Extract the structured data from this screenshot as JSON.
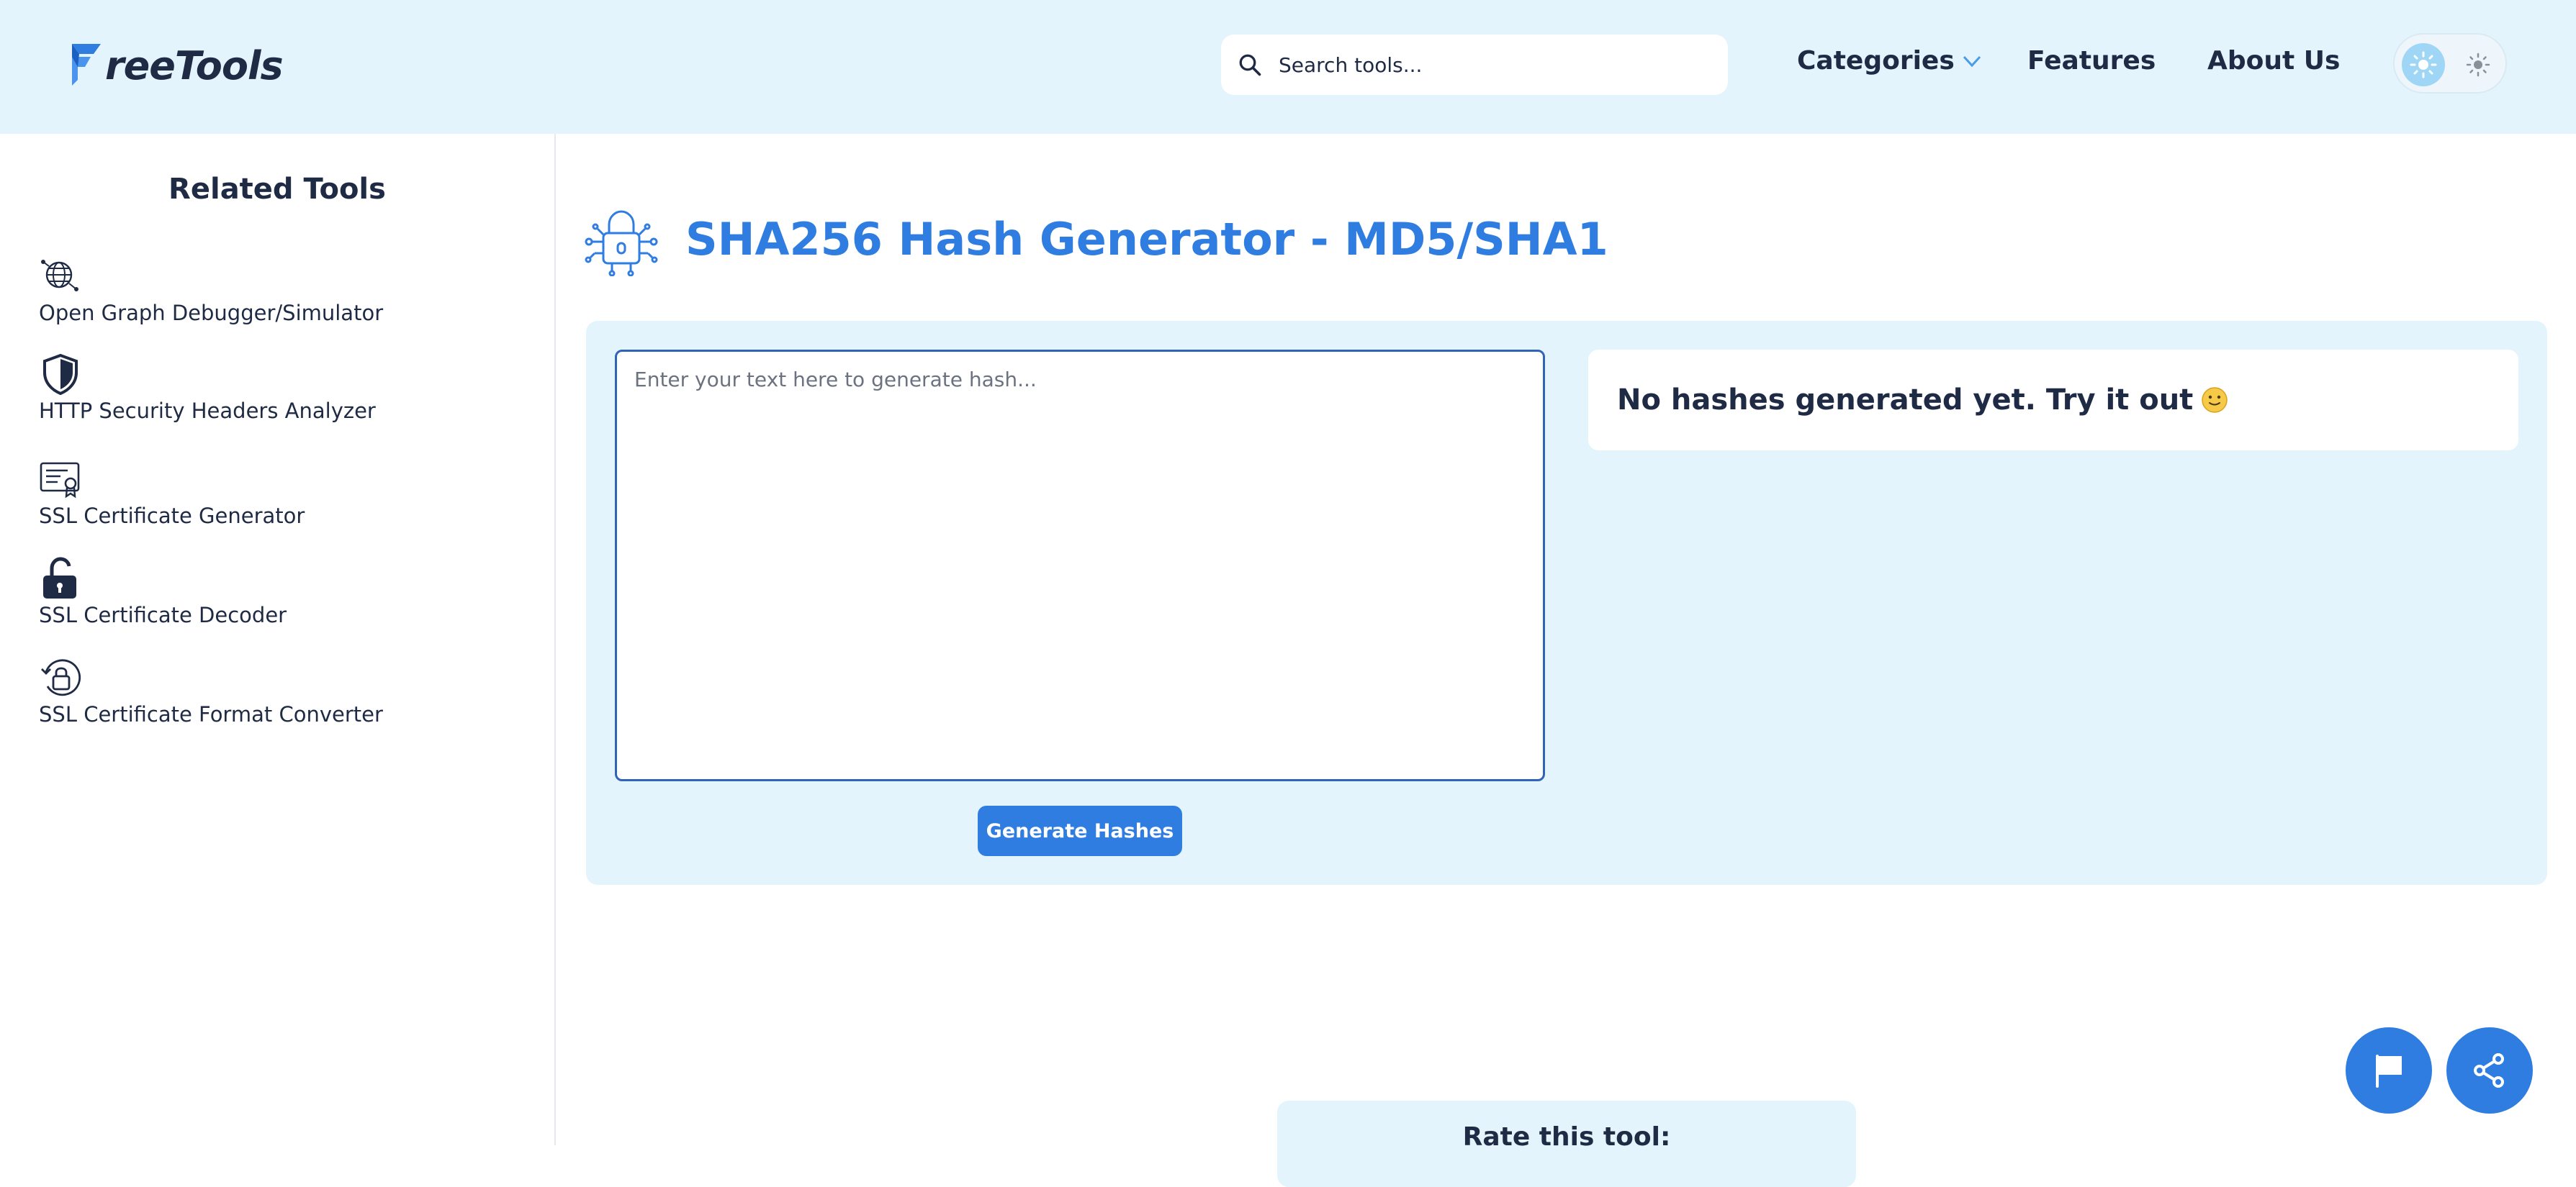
{
  "header": {
    "logo_text": "reeTools",
    "search_placeholder": "Search tools...",
    "nav": {
      "categories": "Categories",
      "features": "Features",
      "about": "About Us"
    }
  },
  "sidebar": {
    "title": "Related Tools",
    "items": [
      {
        "label": "Open Graph Debugger/Simulator",
        "icon": "globe-network-icon"
      },
      {
        "label": "HTTP Security Headers Analyzer",
        "icon": "shield-icon"
      },
      {
        "label": "SSL Certificate Generator",
        "icon": "certificate-icon"
      },
      {
        "label": "SSL Certificate Decoder",
        "icon": "unlock-icon"
      },
      {
        "label": "SSL Certificate Format Converter",
        "icon": "lock-rotate-icon"
      }
    ]
  },
  "main": {
    "title": "SHA256 Hash Generator - MD5/SHA1",
    "input_placeholder": "Enter your text here to generate hash...",
    "generate_label": "Generate Hashes",
    "result_text": "No hashes generated yet. Try it out"
  },
  "rating": {
    "title": "Rate this tool:"
  },
  "colors": {
    "accent": "#2f7de1",
    "header_bg": "#e3f4fc",
    "text": "#1f2a44"
  }
}
